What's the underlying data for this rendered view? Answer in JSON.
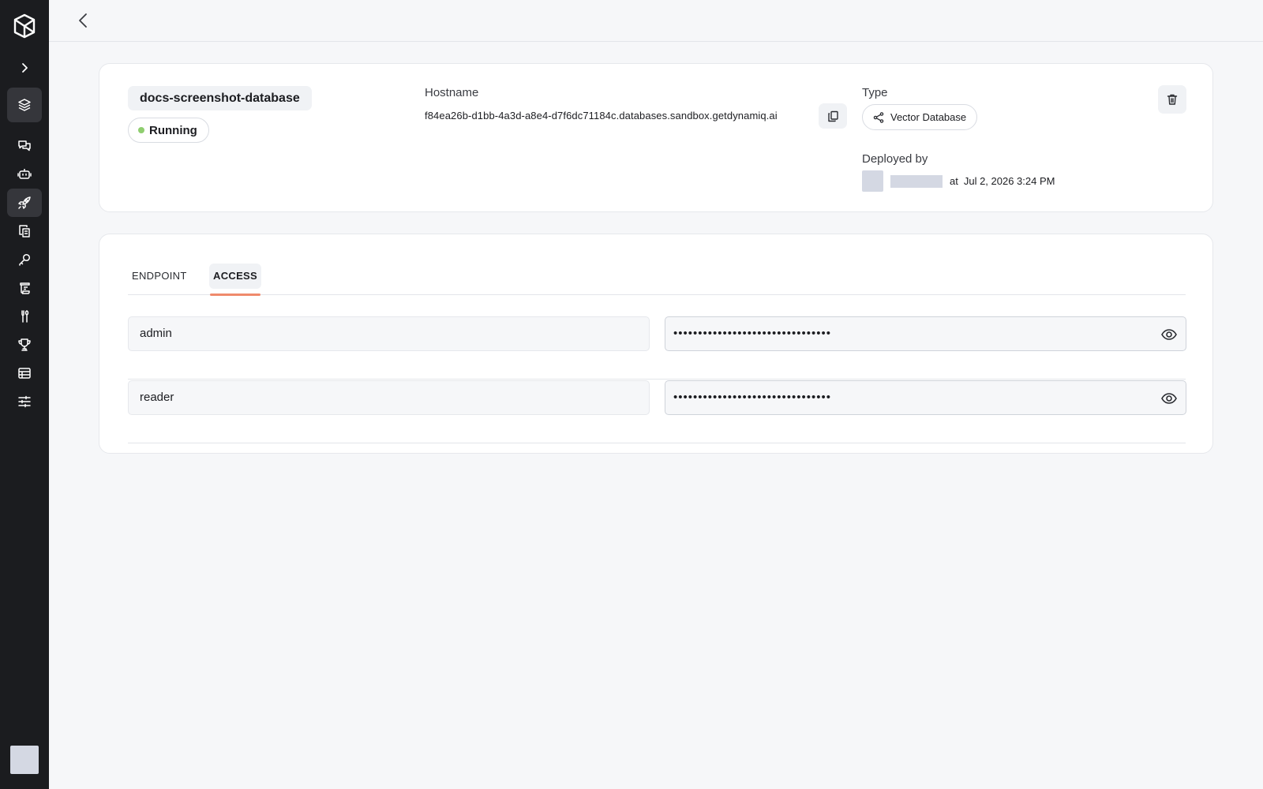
{
  "sidebar": {
    "logo_icon": "cube-logo-icon",
    "expand_icon": "chevron-right-icon",
    "items": [
      {
        "name": "sidebar-item-layers",
        "icon": "layers-icon",
        "active": true
      },
      {
        "name": "sidebar-item-chat",
        "icon": "chat-bubbles-icon",
        "active": false
      },
      {
        "name": "sidebar-item-bot",
        "icon": "bot-icon",
        "active": false
      },
      {
        "name": "sidebar-item-deployments",
        "icon": "rocket-icon",
        "active": true
      },
      {
        "name": "sidebar-item-knowledge",
        "icon": "documents-icon",
        "active": false
      },
      {
        "name": "sidebar-item-keys",
        "icon": "key-icon",
        "active": false
      },
      {
        "name": "sidebar-item-prompts",
        "icon": "scroll-icon",
        "active": false
      },
      {
        "name": "sidebar-item-tools",
        "icon": "tools-icon",
        "active": false
      },
      {
        "name": "sidebar-item-evals",
        "icon": "trophy-icon",
        "active": false
      },
      {
        "name": "sidebar-item-datasets",
        "icon": "table-icon",
        "active": false
      },
      {
        "name": "sidebar-item-settings",
        "icon": "sliders-icon",
        "active": false
      }
    ]
  },
  "header": {
    "back_icon": "chevron-left-icon"
  },
  "database": {
    "name": "docs-screenshot-database",
    "status": "Running",
    "status_color": "#8fce6f",
    "hostname_label": "Hostname",
    "hostname": "f84ea26b-d1bb-4a3d-a8e4-d7f6dc71184c.databases.sandbox.getdynamiq.ai",
    "type_label": "Type",
    "type": "Vector Database",
    "deployed_by_label": "Deployed by",
    "deployed_at_prefix": "at",
    "deployed_at": "Jul 2, 2026 3:24 PM"
  },
  "tabs": [
    {
      "label": "ENDPOINT",
      "active": false
    },
    {
      "label": "ACCESS",
      "active": true
    }
  ],
  "accent_color": "#ef8a6c",
  "credentials": [
    {
      "username": "admin",
      "password_masked": "••••••••••••••••••••••••••••••••"
    },
    {
      "username": "reader",
      "password_masked": "••••••••••••••••••••••••••••••••"
    }
  ]
}
